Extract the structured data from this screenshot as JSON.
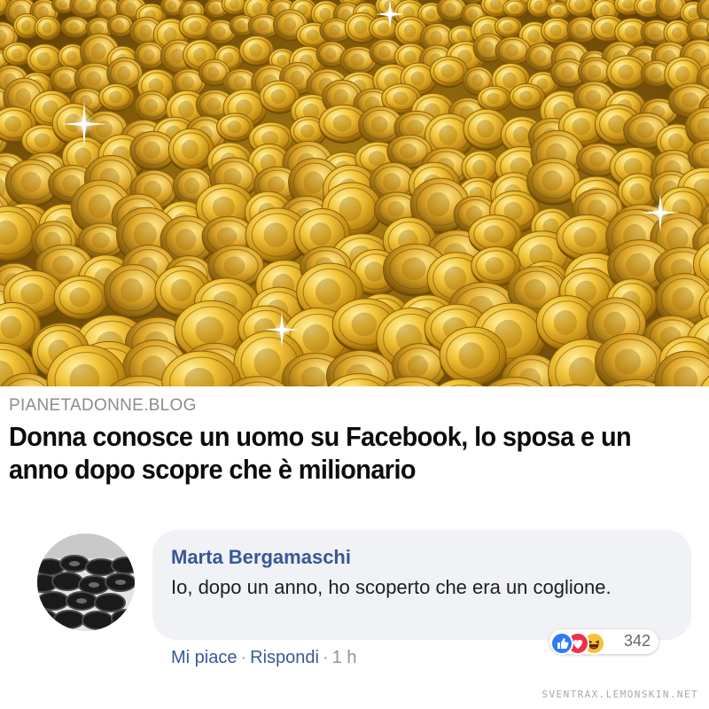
{
  "post": {
    "image": {
      "icon": "gold-coins-photo"
    },
    "link_domain": "PIANETADONNE.BLOG",
    "headline": "Donna conosce un uomo su Facebook, lo sposa e un anno dopo scopre che è milionario"
  },
  "comment": {
    "avatar_icon": "tires-photo-avatar",
    "author": "Marta Bergamaschi",
    "text": "Io, dopo un anno, ho scoperto che era un coglione.",
    "reactions": {
      "icons": [
        "like-icon",
        "love-icon",
        "haha-icon"
      ],
      "count": "342"
    },
    "actions": {
      "like": "Mi piace",
      "separator": "·",
      "reply": "Rispondi",
      "time": "1 h"
    }
  },
  "watermark": "SVENTRAX.LEMONSKIN.NET",
  "colors": {
    "link_blue": "#385898",
    "bubble_bg": "#f1f2f5",
    "meta_gray": "#90949c",
    "like_blue": "#2e7bf6",
    "love_red": "#f0304c",
    "haha_yellow": "#f7c23a"
  }
}
